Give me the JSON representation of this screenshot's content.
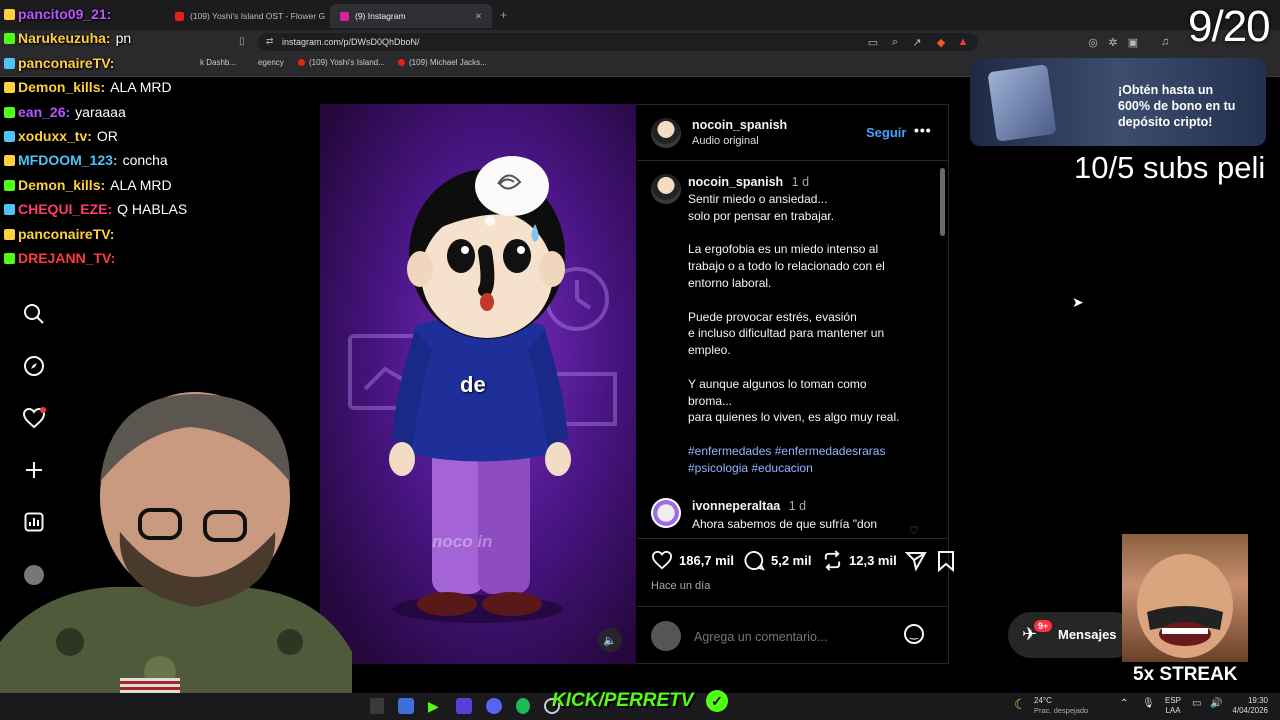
{
  "browser": {
    "tabs": [
      {
        "label": "(109) Yoshi's Island OST - Flower Gar",
        "favicon_color": "#e62117"
      },
      {
        "label": "(9) Instagram",
        "favicon_color": "#d6249f"
      }
    ],
    "url": "instagram.com/p/DWsD0QhDboN/",
    "bookmarks": [
      "k Dashb...",
      "egency",
      "(109) Yoshi's Island...",
      "(109) Michael Jacks..."
    ]
  },
  "post": {
    "username": "nocoin_spanish",
    "audio": "Audio original",
    "follow_label": "Seguir",
    "more_icon": "more-horizontal-icon",
    "video_caption_word": "de",
    "video_watermark": "noco in",
    "caption_user": "nocoin_spanish",
    "caption_time": "1 d",
    "caption_lines": [
      "Sentir miedo o ansiedad...",
      "solo por pensar en trabajar.",
      "",
      "La ergofobia es un miedo intenso al",
      "trabajo o a todo lo relacionado con el",
      "entorno laboral.",
      "",
      "Puede provocar estrés, evasión",
      "e incluso dificultad para mantener un",
      "empleo.",
      "",
      "Y aunque algunos lo toman como",
      "broma...",
      "para quienes lo viven, es algo muy real."
    ],
    "hashtags_line1": "#enfermedades #enfermedadesraras",
    "hashtags_line2": "#psicologia #educacion",
    "comment_user": "ivonneperaltaa",
    "comment_time": "1 d",
    "comment_text": "Ahora sabemos de que sufría \"don",
    "likes": "186,7 mil",
    "comments": "5,2 mil",
    "reposts": "12,3 mil",
    "posted": "Hace un día",
    "comment_placeholder": "Agrega un comentario..."
  },
  "sidebar": {
    "icons": [
      "search-icon",
      "explore-icon",
      "heart-icon",
      "create-icon",
      "dashboard-icon",
      "profile-icon"
    ]
  },
  "messages": {
    "label": "Mensajes",
    "badge": "9+"
  },
  "ad": {
    "text": "¡Obtén hasta un 600% de bono en tu depósito cripto!"
  },
  "stream": {
    "counter": "9/20",
    "subs": "10/5 subs peli",
    "streak": "5x STREAK",
    "channel": "KICK/PERRETV",
    "chat": [
      {
        "user": "pancito09_21:",
        "msg": "",
        "color": "#bb55ff"
      },
      {
        "user": "Narukeuzuha:",
        "msg": "pn",
        "color": "#ffcf40"
      },
      {
        "user": "panconaireTV:",
        "msg": "",
        "color": "#ffcf40"
      },
      {
        "user": "Demon_kills:",
        "msg": "ALA MRD",
        "color": "#ffcf40"
      },
      {
        "user": "ean_26:",
        "msg": "yaraaaa",
        "color": "#bb55ff"
      },
      {
        "user": "xoduxx_tv:",
        "msg": "OR",
        "color": "#ffcf40"
      },
      {
        "user": "MFDOOM_123:",
        "msg": "concha",
        "color": "#4fc3f7"
      },
      {
        "user": "Demon_kills:",
        "msg": "ALA MRD",
        "color": "#ffcf40"
      },
      {
        "user": "CHEQUI_EZE:",
        "msg": "Q HABLAS",
        "color": "#ff3b6b"
      },
      {
        "user": "panconaireTV:",
        "msg": "",
        "color": "#ffcf40"
      },
      {
        "user": "DREJANN_TV:",
        "msg": "",
        "color": "#ff3b3b"
      }
    ]
  },
  "taskbar": {
    "weather_temp": "24°C",
    "weather_desc": "Prac. despejado",
    "lang1": "ESP",
    "lang2": "LAA",
    "time": "19:30",
    "date": "4/04/2026"
  }
}
